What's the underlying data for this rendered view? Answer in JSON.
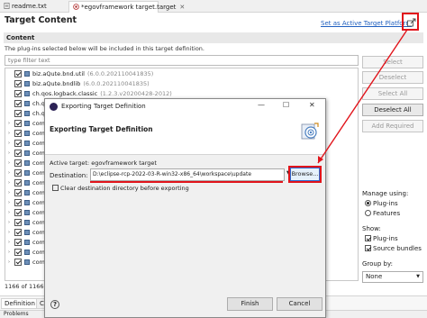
{
  "editor_tabs": [
    {
      "label": "readme.txt"
    },
    {
      "label": "*egovframework target.target"
    }
  ],
  "header": {
    "title": "Target Content",
    "set_active_link": "Set as Active Target Platform"
  },
  "content_section": {
    "title": "Content",
    "description": "The plug-ins selected below will be included in this target definition.",
    "filter_placeholder": "type filter text"
  },
  "tree_rows": [
    {
      "name": "biz.aQute.bnd.util",
      "version": "(6.0.0.202110041835)",
      "expandable": false
    },
    {
      "name": "biz.aQute.bndlib",
      "version": "(6.0.0.202110041835)",
      "expandable": false
    },
    {
      "name": "ch.qos.logback.classic",
      "version": "(1.2.3.v20200428-2012)",
      "expandable": false
    },
    {
      "name": "ch.q",
      "version": "",
      "expandable": false
    },
    {
      "name": "ch.q",
      "version": "",
      "expandable": false
    },
    {
      "name": "com",
      "version": "",
      "expandable": true
    },
    {
      "name": "com",
      "version": "",
      "expandable": true
    },
    {
      "name": "com",
      "version": "",
      "expandable": true
    },
    {
      "name": "com",
      "version": "",
      "expandable": true
    },
    {
      "name": "com",
      "version": "",
      "expandable": true
    },
    {
      "name": "com",
      "version": "",
      "expandable": true
    },
    {
      "name": "com",
      "version": "",
      "expandable": true
    },
    {
      "name": "com",
      "version": "",
      "expandable": true
    },
    {
      "name": "com",
      "version": "",
      "expandable": true
    },
    {
      "name": "com",
      "version": "",
      "expandable": true
    },
    {
      "name": "com",
      "version": "",
      "expandable": true
    },
    {
      "name": "com",
      "version": "",
      "expandable": true
    },
    {
      "name": "com",
      "version": "",
      "expandable": true
    },
    {
      "name": "com",
      "version": "",
      "expandable": true
    },
    {
      "name": "com",
      "version": "",
      "expandable": true
    }
  ],
  "status_text": "1166 of 1166",
  "right_buttons": {
    "select": "Select",
    "deselect": "Deselect",
    "select_all": "Select All",
    "deselect_all": "Deselect All",
    "add_required": "Add Required"
  },
  "manage_using": {
    "label": "Manage using:",
    "plugins": "Plug-ins",
    "features": "Features"
  },
  "show": {
    "label": "Show:",
    "plugins": "Plug-ins",
    "source_bundles": "Source bundles"
  },
  "group_by": {
    "label": "Group by:",
    "value": "None"
  },
  "bottom_tabs": [
    {
      "label": "Definition"
    },
    {
      "label": "Con"
    }
  ],
  "problems_label": "Problems",
  "dialog": {
    "title": "Exporting Target Definition",
    "heading": "Exporting Target Definition",
    "active_target": "Active target: egovframework target",
    "destination_label": "Destination:",
    "destination_value": "D:\\eclipse-rcp-2022-03-R-win32-x86_64\\workspace\\update",
    "browse_button": "Browse...",
    "clear_label": "Clear destination directory before exporting",
    "help": "?",
    "finish_button": "Finish",
    "cancel_button": "Cancel",
    "controls": {
      "minimize": "—",
      "maximize": "☐",
      "close": "✕"
    }
  },
  "colors": {
    "annotation_red": "#e1141b",
    "link_blue": "#1f5fbf",
    "dialog_bg": "#f0f0f0"
  },
  "icons": {
    "header_export": "export-icon",
    "dialog_app": "eclipse-icon",
    "dialog_wizard": "target-export-wizard-icon",
    "plugin": "plugin-icon"
  }
}
